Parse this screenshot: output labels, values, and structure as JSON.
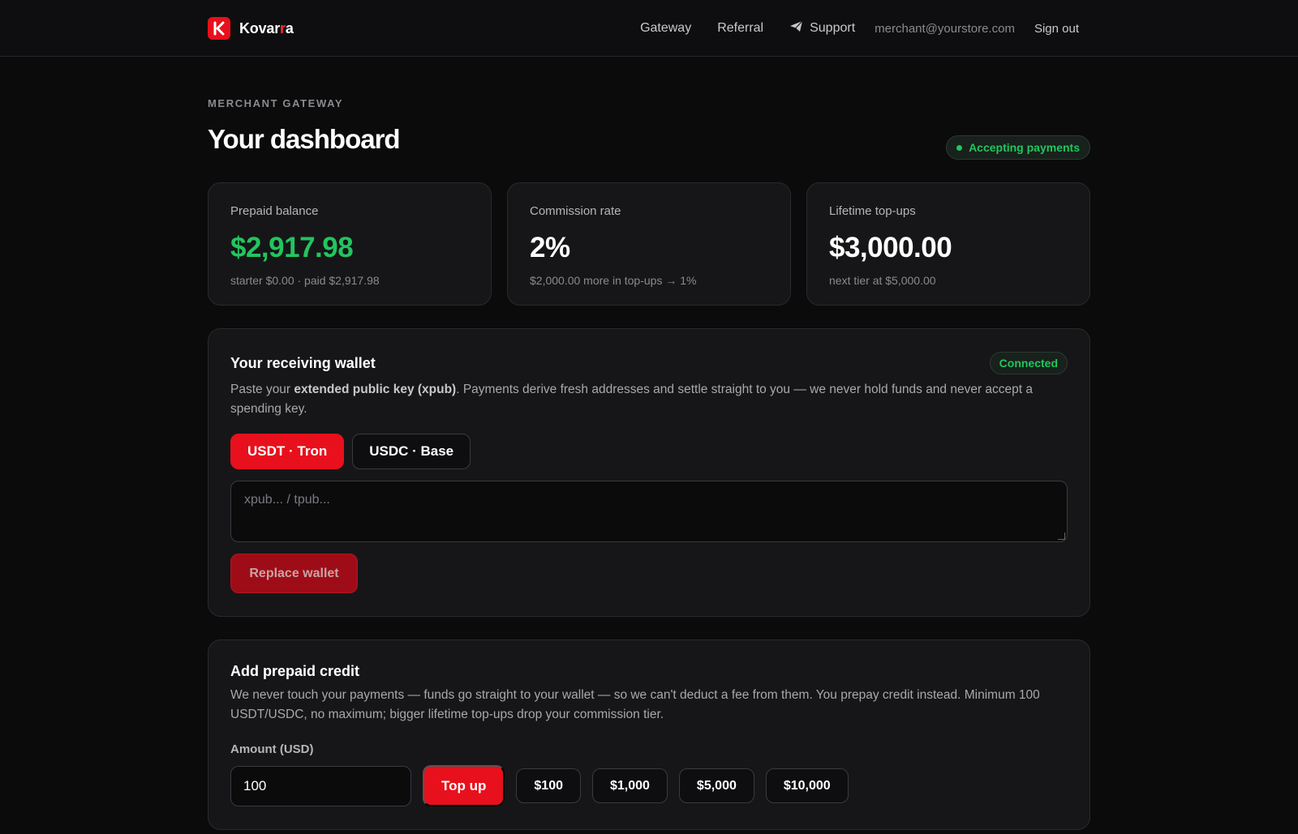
{
  "header": {
    "brand_prefix": "Kovar",
    "brand_accent": "r",
    "brand_suffix": "a",
    "nav": {
      "gateway": "Gateway",
      "referral": "Referral",
      "support": "Support"
    },
    "email": "merchant@yourstore.com",
    "sign_out": "Sign out"
  },
  "page": {
    "eyebrow": "MERCHANT GATEWAY",
    "title": "Your dashboard",
    "status": "Accepting payments"
  },
  "stats": [
    {
      "label": "Prepaid balance",
      "value": "$2,917.98",
      "sub": "starter $0.00 · paid $2,917.98"
    },
    {
      "label": "Commission rate",
      "value": "2%",
      "sub": "$2,000.00 more in top-ups → 1%"
    },
    {
      "label": "Lifetime top-ups",
      "value": "$3,000.00",
      "sub": "next tier at $5,000.00"
    }
  ],
  "wallet": {
    "title": "Your receiving wallet",
    "badge": "Connected",
    "desc_before": "Paste your ",
    "desc_bold": "extended public key (xpub)",
    "desc_after": ". Payments derive fresh addresses and settle straight to you — we never hold funds and never accept a spending key.",
    "networks": [
      "USDT · Tron",
      "USDC · Base"
    ],
    "selected_network": "USDT · Tron",
    "input_placeholder": "xpub... / tpub...",
    "input_value": "",
    "replace_label": "Replace wallet"
  },
  "credit": {
    "title": "Add prepaid credit",
    "desc": "We never touch your payments — funds go straight to your wallet — so we can't deduct a fee from them. You prepay credit instead. Minimum 100 USDT/USDC, no maximum; bigger lifetime top-ups drop your commission tier.",
    "amount_label": "Amount (USD)",
    "amount_value": "100",
    "topup_label": "Top up",
    "presets": [
      "$100",
      "$1,000",
      "$5,000",
      "$10,000"
    ]
  },
  "colors": {
    "accent": "#e8101c",
    "success": "#22c55e",
    "background": "#0b0b0c",
    "card": "#161618"
  },
  "icons": {
    "brand": "kovarra-logo-icon",
    "support": "send-plane-icon"
  }
}
